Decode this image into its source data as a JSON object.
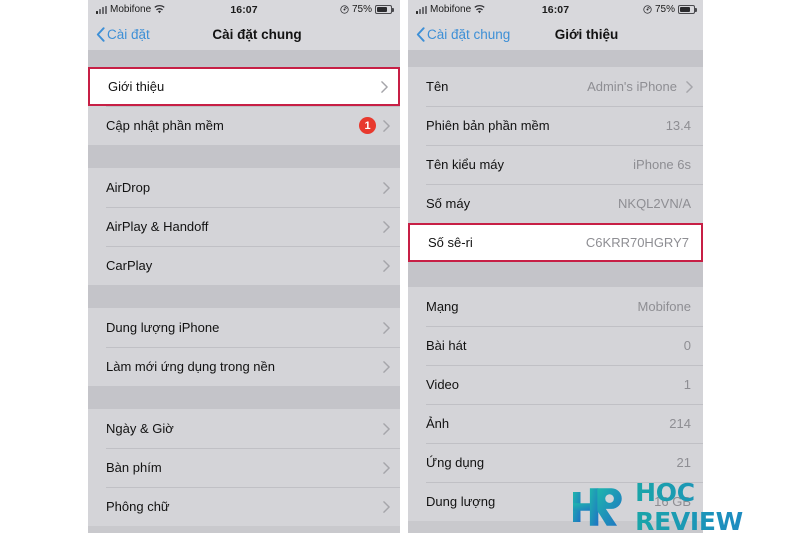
{
  "status_bar": {
    "carrier": "Mobifone",
    "time": "16:07",
    "battery_percent": "75%",
    "wifi_icon": "wifi-icon",
    "signal_icon": "signal-strength-icon",
    "lock_icon": "rotation-lock-icon",
    "battery_icon": "battery-icon"
  },
  "left_phone": {
    "nav": {
      "back_label": "Cài đặt",
      "title": "Cài đặt chung",
      "back_icon": "chevron-left-icon"
    },
    "groups": [
      {
        "rows": [
          {
            "label": "Giới thiệu",
            "value": "",
            "chevron": true,
            "badge": "",
            "highlighted": true
          },
          {
            "label": "Cập nhật phần mềm",
            "value": "",
            "chevron": true,
            "badge": "1",
            "highlighted": false
          }
        ]
      },
      {
        "rows": [
          {
            "label": "AirDrop",
            "value": "",
            "chevron": true,
            "badge": "",
            "highlighted": false
          },
          {
            "label": "AirPlay & Handoff",
            "value": "",
            "chevron": true,
            "badge": "",
            "highlighted": false
          },
          {
            "label": "CarPlay",
            "value": "",
            "chevron": true,
            "badge": "",
            "highlighted": false
          }
        ]
      },
      {
        "rows": [
          {
            "label": "Dung lượng iPhone",
            "value": "",
            "chevron": true,
            "badge": "",
            "highlighted": false
          },
          {
            "label": "Làm mới ứng dụng trong nền",
            "value": "",
            "chevron": true,
            "badge": "",
            "highlighted": false
          }
        ]
      },
      {
        "rows": [
          {
            "label": "Ngày & Giờ",
            "value": "",
            "chevron": true,
            "badge": "",
            "highlighted": false
          },
          {
            "label": "Bàn phím",
            "value": "",
            "chevron": true,
            "badge": "",
            "highlighted": false
          },
          {
            "label": "Phông chữ",
            "value": "",
            "chevron": true,
            "badge": "",
            "highlighted": false
          }
        ]
      }
    ]
  },
  "right_phone": {
    "nav": {
      "back_label": "Cài đặt chung",
      "title": "Giới thiệu",
      "back_icon": "chevron-left-icon"
    },
    "groups": [
      {
        "rows": [
          {
            "label": "Tên",
            "value": "Admin's iPhone",
            "chevron": true,
            "badge": "",
            "highlighted": false
          },
          {
            "label": "Phiên bản phần mềm",
            "value": "13.4",
            "chevron": false,
            "badge": "",
            "highlighted": false
          },
          {
            "label": "Tên kiểu máy",
            "value": "iPhone 6s",
            "chevron": false,
            "badge": "",
            "highlighted": false
          },
          {
            "label": "Số máy",
            "value": "NKQL2VN/A",
            "chevron": false,
            "badge": "",
            "highlighted": false
          },
          {
            "label": "Số sê-ri",
            "value": "C6KRR70HGRY7",
            "chevron": false,
            "badge": "",
            "highlighted": true
          }
        ]
      },
      {
        "rows": [
          {
            "label": "Mạng",
            "value": "Mobifone",
            "chevron": false,
            "badge": "",
            "highlighted": false
          },
          {
            "label": "Bài hát",
            "value": "0",
            "chevron": false,
            "badge": "",
            "highlighted": false
          },
          {
            "label": "Video",
            "value": "1",
            "chevron": false,
            "badge": "",
            "highlighted": false
          },
          {
            "label": "Ảnh",
            "value": "214",
            "chevron": false,
            "badge": "",
            "highlighted": false
          },
          {
            "label": "Ứng dụng",
            "value": "21",
            "chevron": false,
            "badge": "",
            "highlighted": false
          },
          {
            "label": "Dung lượng",
            "value": "16 GB",
            "chevron": false,
            "badge": "",
            "highlighted": false
          }
        ]
      }
    ]
  },
  "watermark": {
    "monogram": "HR",
    "text": "HOC REVIEW"
  },
  "colors": {
    "accent_blue": "#3d8fd6",
    "highlight_border": "#c71f45",
    "badge_red": "#e8392e",
    "row_bg": "#d4d4d8",
    "gap_bg": "#c4c4c9",
    "value_gray": "#8e8e93",
    "watermark_teal": "#1aa5a8"
  }
}
